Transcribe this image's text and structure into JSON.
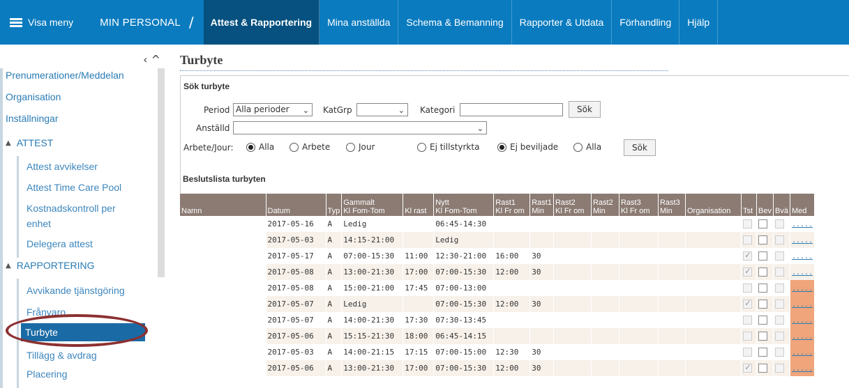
{
  "topnav": {
    "menu_label": "Visa meny",
    "brand": "MIN PERSONAL",
    "separator": "/",
    "tabs": [
      "Attest & Rapportering",
      "Mina anställda",
      "Schema & Bemanning",
      "Rapporter & Utdata",
      "Förhandling",
      "Hjälp"
    ],
    "active_tab": "Attest & Rapportering"
  },
  "sidebar": {
    "collapse_glyph": "‹ ^",
    "items": [
      "Prenumerationer/Meddelan",
      "Organisation",
      "Inställningar"
    ],
    "section_attest": "ATTEST",
    "attest_items": [
      "Attest avvikelser",
      "Attest Time Care Pool",
      "Kostnadskontroll per",
      "enhet",
      "Delegera attest"
    ],
    "section_rapportering": "RAPPORTERING",
    "rapportering_items": [
      "Avvikande tjänstgöring",
      "Frånvaro",
      "Turbyte",
      "Tillägg & avdrag",
      "Placering"
    ],
    "active_item": "Turbyte"
  },
  "main": {
    "title": "Turbyte",
    "search": {
      "heading": "Sök turbyte",
      "period_label": "Period",
      "period_value": "Alla perioder",
      "katgrp_label": "KatGrp",
      "katgrp_value": "",
      "kategori_label": "Kategori",
      "kategori_value": "",
      "sok1": "Sök",
      "anstalld_label": "Anställd",
      "anstalld_value": "",
      "arbete_label": "Arbete/Jour:",
      "radio_group1": [
        "Alla",
        "Arbete",
        "Jour"
      ],
      "radio_group2": [
        "Ej tillstyrkta",
        "Ej beviljade",
        "Alla"
      ],
      "sok2": "Sök"
    },
    "list_title": "Beslutslista turbyten",
    "table": {
      "headers": [
        "Namn",
        "Datum",
        "Typ",
        "Gammalt\nKl Fom-Tom",
        "Kl rast",
        "Nytt\nKl Fom-Tom",
        "Rast1\nKl Fr om",
        "Rast1\nMin",
        "Rast2\nKl Fr om",
        "Rast2\nMin",
        "Rast3\nKl Fr om",
        "Rast3\nMin",
        "Organisation",
        "Tst",
        "Bev",
        "Bvä",
        "Med"
      ],
      "rows": [
        {
          "datum": "2017-05-16",
          "typ": "A",
          "gammalt": "Ledig",
          "klrast": "",
          "nytt": "06:45-14:30",
          "r1": "",
          "r1min": "",
          "tst": false,
          "orange": false
        },
        {
          "datum": "2017-05-03",
          "typ": "A",
          "gammalt": "14:15-21:00",
          "klrast": "",
          "nytt": "Ledig",
          "r1": "",
          "r1min": "",
          "tst": false,
          "orange": false
        },
        {
          "datum": "2017-05-17",
          "typ": "A",
          "gammalt": "07:00-15:30",
          "klrast": "11:00",
          "nytt": "12:30-21:00",
          "r1": "16:00",
          "r1min": "30",
          "tst": true,
          "orange": false
        },
        {
          "datum": "2017-05-08",
          "typ": "A",
          "gammalt": "13:00-21:30",
          "klrast": "17:00",
          "nytt": "07:00-15:30",
          "r1": "12:00",
          "r1min": "30",
          "tst": true,
          "orange": false
        },
        {
          "datum": "2017-05-08",
          "typ": "A",
          "gammalt": "15:00-21:00",
          "klrast": "17:45",
          "nytt": "07:00-13:00",
          "r1": "",
          "r1min": "",
          "tst": false,
          "orange": true
        },
        {
          "datum": "2017-05-07",
          "typ": "A",
          "gammalt": "Ledig",
          "klrast": "",
          "nytt": "07:00-15:30",
          "r1": "12:00",
          "r1min": "30",
          "tst": true,
          "orange": true
        },
        {
          "datum": "2017-05-07",
          "typ": "A",
          "gammalt": "14:00-21:30",
          "klrast": "17:30",
          "nytt": "07:30-13:45",
          "r1": "",
          "r1min": "",
          "tst": false,
          "orange": true
        },
        {
          "datum": "2017-05-06",
          "typ": "A",
          "gammalt": "15:15-21:30",
          "klrast": "18:00",
          "nytt": "06:45-14:15",
          "r1": "",
          "r1min": "",
          "tst": false,
          "orange": true
        },
        {
          "datum": "2017-05-03",
          "typ": "A",
          "gammalt": "14:00-21:15",
          "klrast": "17:15",
          "nytt": "07:00-15:00",
          "r1": "12:30",
          "r1min": "30",
          "tst": false,
          "orange": true
        },
        {
          "datum": "2017-05-06",
          "typ": "A",
          "gammalt": "13:00-21:30",
          "klrast": "17:00",
          "nytt": "07:00-15:30",
          "r1": "12:00",
          "r1min": "30",
          "tst": true,
          "orange": true
        }
      ],
      "link_text": "....."
    }
  },
  "colors": {
    "nav_bg": "#0a7bbf",
    "nav_active": "#06517f",
    "header_bg": "#8b7b73",
    "row_alt": "#f7f1ea",
    "highlight_oval": "#8c3030",
    "med_orange": "#f0a57a"
  }
}
